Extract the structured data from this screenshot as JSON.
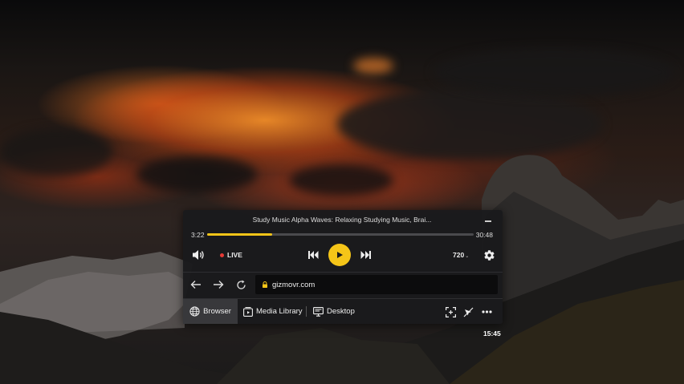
{
  "player": {
    "title": "Study Music Alpha Waves: Relaxing Studying Music, Brai...",
    "elapsed": "3:22",
    "duration": "30:48",
    "progress_fraction": 0.245,
    "live_label": "LIVE",
    "quality": "720",
    "accent_color": "#f5c518",
    "live_color": "#e53935"
  },
  "browser": {
    "url": "gizmovr.com"
  },
  "tabs": [
    {
      "label": "Browser",
      "icon": "globe-icon",
      "active": true
    },
    {
      "label": "Media Library",
      "icon": "media-library-icon",
      "active": false
    },
    {
      "label": "Desktop",
      "icon": "monitor-icon",
      "active": false
    }
  ],
  "toolbar_icons": [
    "recenter-icon",
    "pointer-off-icon",
    "more-icon"
  ],
  "clock": "15:45"
}
